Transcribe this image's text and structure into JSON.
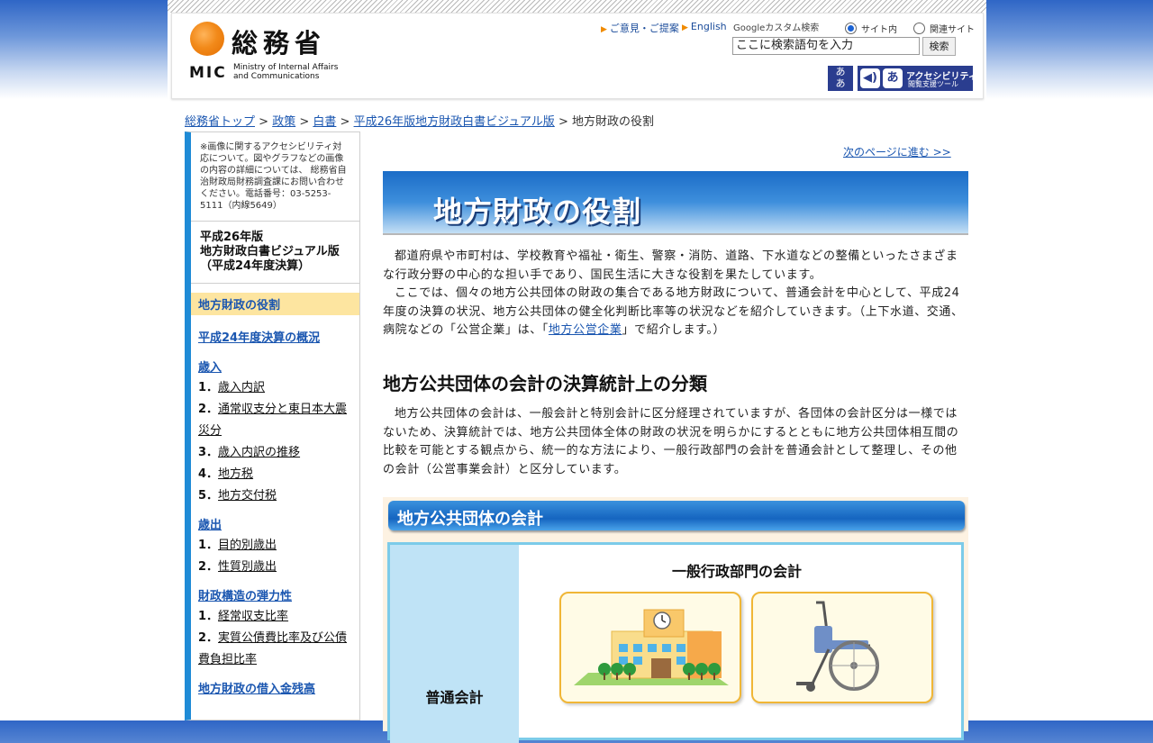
{
  "header": {
    "logo_ja": "総務省",
    "logo_abbr": "MIC",
    "logo_en_line1": "Ministry of Internal Affairs",
    "logo_en_line2": "and Communications",
    "link_opinion": "ご意見・ご提案",
    "link_english": "English",
    "google_label": "Googleカスタム検索",
    "radio_site": "サイト内",
    "radio_related": "関連サイト",
    "search_value": "ここに検索語句を入力",
    "search_button": "検索",
    "mojiban_label": "あ/あ",
    "accessibility_title": "アクセシビリティ",
    "accessibility_sub": "閲覧支援ツール"
  },
  "breadcrumb": {
    "items": [
      "総務省トップ",
      "政策",
      "白書",
      "平成26年版地方財政白書ビジュアル版"
    ],
    "current": "地方財政の役割",
    "sep": " > "
  },
  "sidebar": {
    "note": "※画像に関するアクセシビリティ対応について。図やグラフなどの画像の内容の詳細については、 総務省自治財政局財務調査課にお問い合わせください。電話番号：03-5253-5111（内線5649）",
    "pub_line1": "平成26年版",
    "pub_line2": "地方財政白書ビジュアル版",
    "pub_line3": "（平成24年度決算）",
    "current": "地方財政の役割",
    "overview": "平成24年度決算の概況",
    "sections": [
      {
        "title": "歳入",
        "items": [
          {
            "num": "1．",
            "label": "歳入内訳"
          },
          {
            "num": "2．",
            "label": "通常収支分と東日本大震災分"
          },
          {
            "num": "3．",
            "label": "歳入内訳の推移"
          },
          {
            "num": "4．",
            "label": "地方税"
          },
          {
            "num": "5．",
            "label": "地方交付税"
          }
        ]
      },
      {
        "title": "歳出",
        "items": [
          {
            "num": "1．",
            "label": "目的別歳出"
          },
          {
            "num": "2．",
            "label": "性質別歳出"
          }
        ]
      },
      {
        "title": "財政構造の弾力性",
        "items": [
          {
            "num": "1．",
            "label": "経常収支比率"
          },
          {
            "num": "2．",
            "label": "実質公債費比率及び公債費負担比率"
          }
        ]
      },
      {
        "title": "地方財政の借入金残高",
        "items": []
      }
    ]
  },
  "main": {
    "next_link": "次のページに進む >>",
    "banner_title": "地方財政の役割",
    "intro_p1": "都道府県や市町村は、学校教育や福祉・衛生、警察・消防、道路、下水道などの整備といったさまざまな行政分野の中心的な担い手であり、国民生活に大きな役割を果たしています。",
    "intro_p2_a": "ここでは、個々の地方公共団体の財政の集合である地方財政について、普通会計を中心として、平成24年度の決算の状況、地方公共団体の健全化判断比率等の状況などを紹介していきます。（上下水道、交通、病院などの「公営企業」は、「",
    "intro_p2_link": "地方公営企業",
    "intro_p2_b": "」で紹介します。）",
    "section_heading": "地方公共団体の会計の決算統計上の分類",
    "section_p": "地方公共団体の会計は、一般会計と特別会計に区分経理されていますが、各団体の会計区分は一様ではないため、決算統計では、地方公共団体全体の財政の状況を明らかにするとともに地方公共団体相互間の比較を可能とする観点から、統一的な方法により、一般行政部門の会計を普通会計として整理し、その他の会計（公営事業会計）と区分しています。",
    "diagram_title": "地方公共団体の会計",
    "diagram_col_title": "一般行政部門の会計",
    "diagram_row_label": "普通会計"
  },
  "colors": {
    "accent_blue": "#1f8bd6",
    "link": "#1a56b0",
    "highlight": "#fde5a0",
    "orange": "#f08a00"
  }
}
